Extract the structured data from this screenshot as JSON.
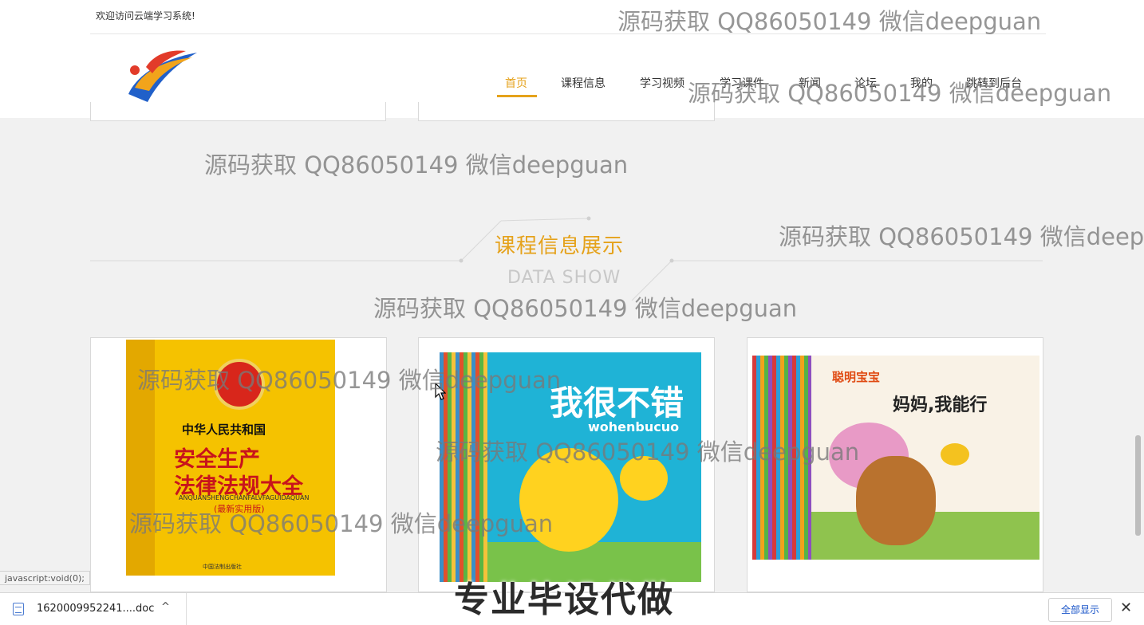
{
  "header": {
    "welcome": "欢迎访问云端学习系统!"
  },
  "nav": [
    {
      "label": "首页",
      "active": true
    },
    {
      "label": "课程信息",
      "active": false
    },
    {
      "label": "学习视频",
      "active": false
    },
    {
      "label": "学习课件",
      "active": false
    },
    {
      "label": "新闻",
      "active": false
    },
    {
      "label": "论坛",
      "active": false
    },
    {
      "label": "我的",
      "active": false
    },
    {
      "label": "跳转到后台",
      "active": false
    }
  ],
  "section": {
    "title": "课程信息展示",
    "subtitle": "DATA SHOW"
  },
  "courses": [
    {
      "cover_lines": [
        "中华人民共和国",
        "安全生产",
        "法律法规大全",
        "ANQUANSHENGCHANFALVFAGUIDAQUAN",
        "(最新实用版)",
        "中国法制出版社"
      ]
    },
    {
      "cover_lines": [
        "我很不错",
        "wohenbucuo"
      ]
    },
    {
      "cover_lines": [
        "聪明宝宝",
        "妈妈,我能行"
      ]
    }
  ],
  "status_bar": "javascript:void(0);",
  "downloads": {
    "file_name": "1620009952241....doc",
    "caret": "^",
    "show_all": "全部显示",
    "close": "✕"
  },
  "watermark": "源码获取 QQ86050149 微信deepguan",
  "overlay_banner": "专业毕设代做",
  "colors": {
    "accent": "#e5a21b",
    "background": "#f1f1f1",
    "link_blue": "#1a55c9"
  }
}
